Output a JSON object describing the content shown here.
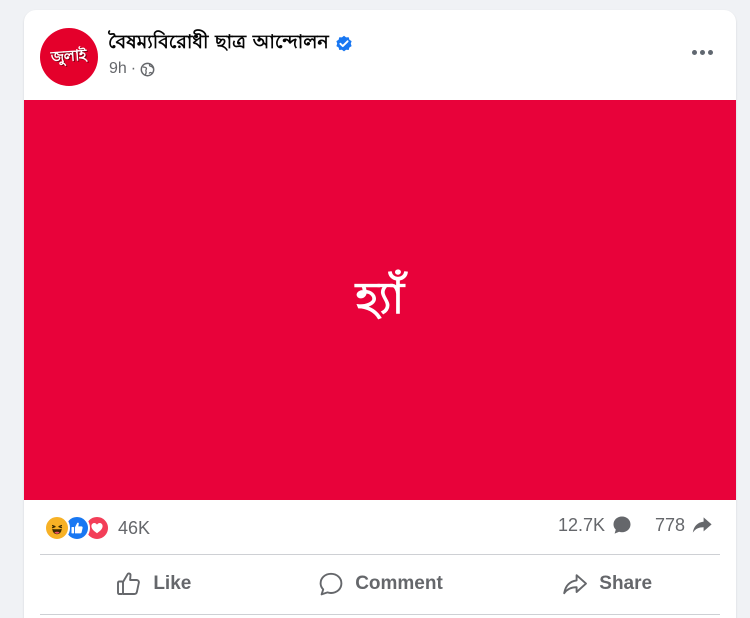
{
  "post": {
    "page_name": "বৈষম্যবিরোধী ছাত্র আন্দোলন",
    "avatar_text": "জুলাই",
    "time": "9h",
    "separator": "·",
    "media_text": "হ্যাঁ"
  },
  "stats": {
    "reaction_count": "46K",
    "comment_count": "12.7K",
    "share_count": "778"
  },
  "actions": {
    "like": "Like",
    "comment": "Comment",
    "share": "Share"
  },
  "icons": {
    "verified": "verified-badge-icon",
    "privacy": "globe-icon",
    "more": "more-options-icon",
    "reactions": [
      "haha-reaction-icon",
      "like-reaction-icon",
      "love-reaction-icon"
    ],
    "comment_stat": "comment-bubble-icon",
    "share_stat": "share-arrow-icon"
  },
  "colors": {
    "media_background": "#e8023a",
    "avatar_background": "#e4002b",
    "verified_blue": "#1877f2",
    "secondary_text": "#65676b"
  }
}
